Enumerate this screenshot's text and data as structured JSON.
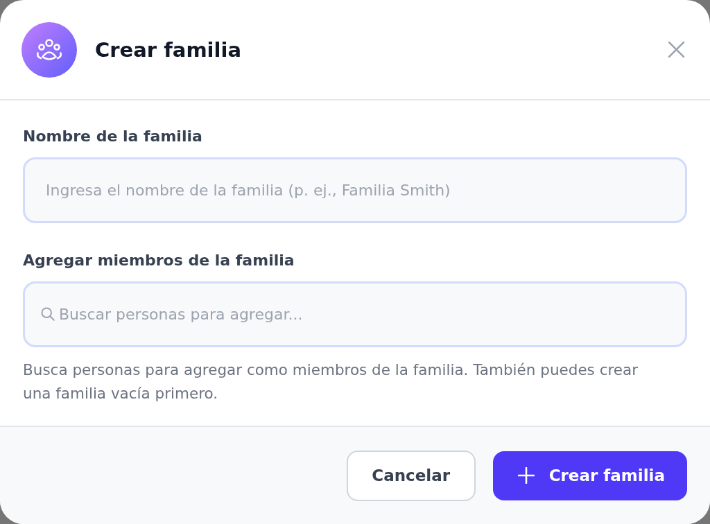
{
  "dialog": {
    "title": "Crear familia"
  },
  "fields": [
    {
      "kind": "text",
      "label": "Nombre de la familia",
      "placeholder": "Ingresa el nombre de la familia (p. ej., Familia Smith)"
    },
    {
      "kind": "search",
      "label": "Agregar miembros de la familia",
      "placeholder": "Buscar personas para agregar..."
    }
  ],
  "help_text": "Busca personas para agregar como miembros de la familia. También puedes crear una familia vacía primero.",
  "buttons": [
    {
      "kind": "secondary",
      "label": "Cancelar"
    },
    {
      "kind": "primary",
      "label": "Crear familia"
    }
  ]
}
